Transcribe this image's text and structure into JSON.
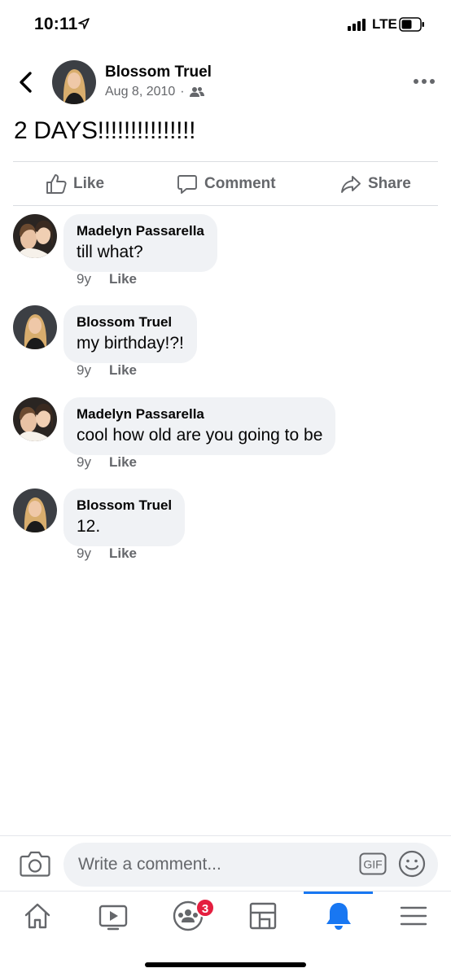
{
  "status_bar": {
    "time": "10:11",
    "network": "LTE"
  },
  "post": {
    "author": "Blossom Truel",
    "date": "Aug 8, 2010",
    "separator": "·",
    "text": "2 DAYS!!!!!!!!!!!!!!!"
  },
  "actions": {
    "like": "Like",
    "comment": "Comment",
    "share": "Share"
  },
  "comments": [
    {
      "author": "Madelyn Passarella",
      "text": "till what?",
      "age": "9y",
      "like": "Like"
    },
    {
      "author": "Blossom Truel",
      "text": "my birthday!?!",
      "age": "9y",
      "like": "Like"
    },
    {
      "author": "Madelyn Passarella",
      "text": "cool how old are you going to be",
      "age": "9y",
      "like": "Like"
    },
    {
      "author": "Blossom Truel",
      "text": "12.",
      "age": "9y",
      "like": "Like"
    }
  ],
  "composer": {
    "placeholder": "Write a comment...",
    "gif": "GIF"
  },
  "tabs": {
    "groups_badge": "3",
    "active": "notifications"
  },
  "colors": {
    "accent": "#1877f2",
    "badge": "#e41e3f",
    "bubble": "#f0f2f5",
    "secondary_text": "#65676b"
  }
}
